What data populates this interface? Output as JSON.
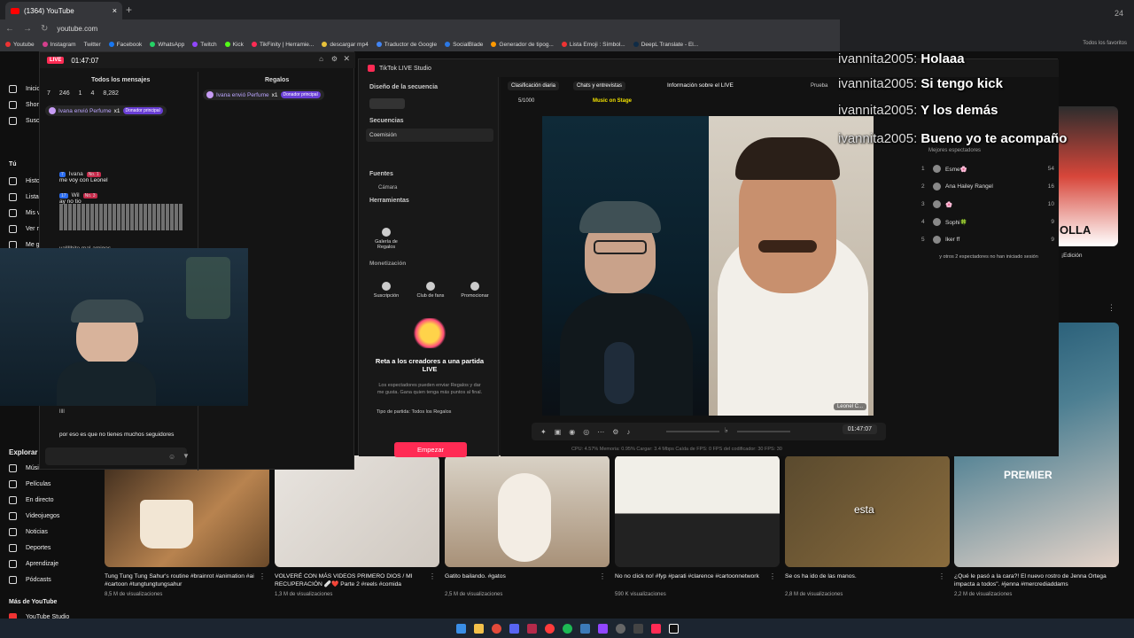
{
  "browser": {
    "tab_title": "(1364) YouTube",
    "new_tab": "+",
    "close_tab": "×",
    "url": "youtube.com",
    "bookmarks": [
      "Youtube",
      "Instagram",
      "Twitter",
      "Facebook",
      "WhatsApp",
      "Twitch",
      "Kick",
      "TikFinity | Herramie...",
      "descargar mp4",
      "Traductor de Google",
      "SocialBlade",
      "Generador de tipog...",
      "Lista Emoji : Símbol...",
      "DeepL Translate - El..."
    ],
    "all_favorites": "Todos los favoritos"
  },
  "youtube_sidebar": {
    "items": [
      "Inicio",
      "Shorts",
      "Suscripciones",
      "Tú",
      "Historial",
      "Listas",
      "Mis videos",
      "Ver más tarde",
      "Me gusta",
      "Videos"
    ],
    "section_tu": "Tú",
    "explore_title": "Explorar",
    "explore": [
      "Música",
      "Películas",
      "En directo",
      "Videojuegos",
      "Noticias",
      "Deportes",
      "Aprendizaje",
      "Pódcasts"
    ],
    "more_title": "Más de YouTube",
    "more_first": "YouTube Studio"
  },
  "videos": [
    {
      "title": "Tung Tung Tung Sahur's routine #brainrot #animation #ai #cartoon #tungtungtungsahur",
      "views": "8,5 M de visualizaciones"
    },
    {
      "title": "VOLVERÉ CON MÁS VIDEOS PRIMERO DIOS / MI RECUPERACIÓN 🩹❤️ Parte 2 #reels #comida",
      "views": "1,3 M de visualizaciones"
    },
    {
      "title": "Gatito bailando. #gatos",
      "views": "2,5 M de visualizaciones"
    },
    {
      "title": "No no click no! #fyp #parati #clarence #cartoonnetwork",
      "views": "590 K visualizaciones"
    },
    {
      "title": "Se os ha ido de las manos.",
      "views": "2,8 M de visualizaciones",
      "caption": "esta"
    },
    {
      "title": "¿Qué le pasó a la cara?! El nuevo rostro de Jenna Ortega impacta a todos\". #jenna #mercrediaddams",
      "views": "2,2 M de visualizaciones",
      "overlay": "PREMIER"
    }
  ],
  "chat_panel": {
    "live_label": "LIVE",
    "timer": "01:47:07",
    "col_all": "Todos los mensajes",
    "col_gifts": "Regalos",
    "stats": [
      "7",
      "246",
      "1",
      "4",
      "8,282"
    ],
    "gift_text": "Ivana envió Perfume",
    "gift_count": "x1",
    "donor_label": "Donador principal",
    "messages": [
      {
        "user": "Ivana",
        "level": "7",
        "rank": "No. 1",
        "text": "me voy con Leonel"
      },
      {
        "user": "Wil",
        "level": "17",
        "rank": "No. 3",
        "text": "ay no tio"
      },
      {
        "user": "",
        "level": "",
        "rank": "",
        "text": "vallllhito mal amigos"
      },
      {
        "user": "",
        "level": "",
        "rank": "",
        "text": "llll"
      },
      {
        "user": "",
        "level": "",
        "rank": "",
        "text": "por eso es que no tienes muchos seguidores"
      }
    ]
  },
  "studio": {
    "title": "TikTok LIVE Studio",
    "scene_design": "Diseño de la secuencia",
    "sequences": "Secuencias",
    "sequence_item": "Coemisión",
    "sources": "Fuentes",
    "camera": "Cámara",
    "tools": "Herramientas",
    "gift_gallery": "Galería de Regalos",
    "monetization": "Monetización",
    "monet_items": [
      "Suscripción",
      "Club de fans",
      "Promocionar"
    ],
    "challenge_title": "Reta a los creadores a una partida LIVE",
    "challenge_desc": "Los espectadores pueden enviar Regalos y dar me gusta. Gana quien tenga más puntos al final.",
    "match_type": "Tipo de partida: Todos los Regalos",
    "start_button": "Empezar",
    "tabs": [
      "Clasificación diaria",
      "Chats y entrevistas"
    ],
    "live_info": "Información sobre el LIVE",
    "test_label": "Prueba",
    "goal": "5/1000",
    "music": "Music on Stage",
    "guest_name": "Leonel C...",
    "timer": "01:47:07",
    "status": "CPU: 4.57%    Memoria: 0.95%    Cargar: 3.4 Mbps    Caída de FPS: 0    FPS del codificador: 30    FPS: 30"
  },
  "viewers": {
    "title": "Mejores espectadores",
    "list": [
      {
        "rank": "1",
        "name": "Esme🌸",
        "score": "54"
      },
      {
        "rank": "2",
        "name": "Ana Hailey Rangel",
        "score": "16"
      },
      {
        "rank": "3",
        "name": "🌸",
        "score": "10"
      },
      {
        "rank": "4",
        "name": "Sophi🍀",
        "score": "9"
      },
      {
        "rank": "5",
        "name": "Iker ff",
        "score": "9"
      }
    ],
    "others": "y otros 2 espectadores no han iniciado sesión"
  },
  "overlay_chat": [
    {
      "user": "ivannita2005:",
      "text": "Holaaa"
    },
    {
      "user": "ivannita2005:",
      "text": "Si tengo kick"
    },
    {
      "user": "ivannita2005:",
      "text": "Y los demás"
    },
    {
      "user": "ivannita2005:",
      "text": "Bueno yo te acompaño"
    }
  ],
  "right_thumb": {
    "text": "OLLA",
    "edition": "¡Edición"
  },
  "top_right_number": "24"
}
